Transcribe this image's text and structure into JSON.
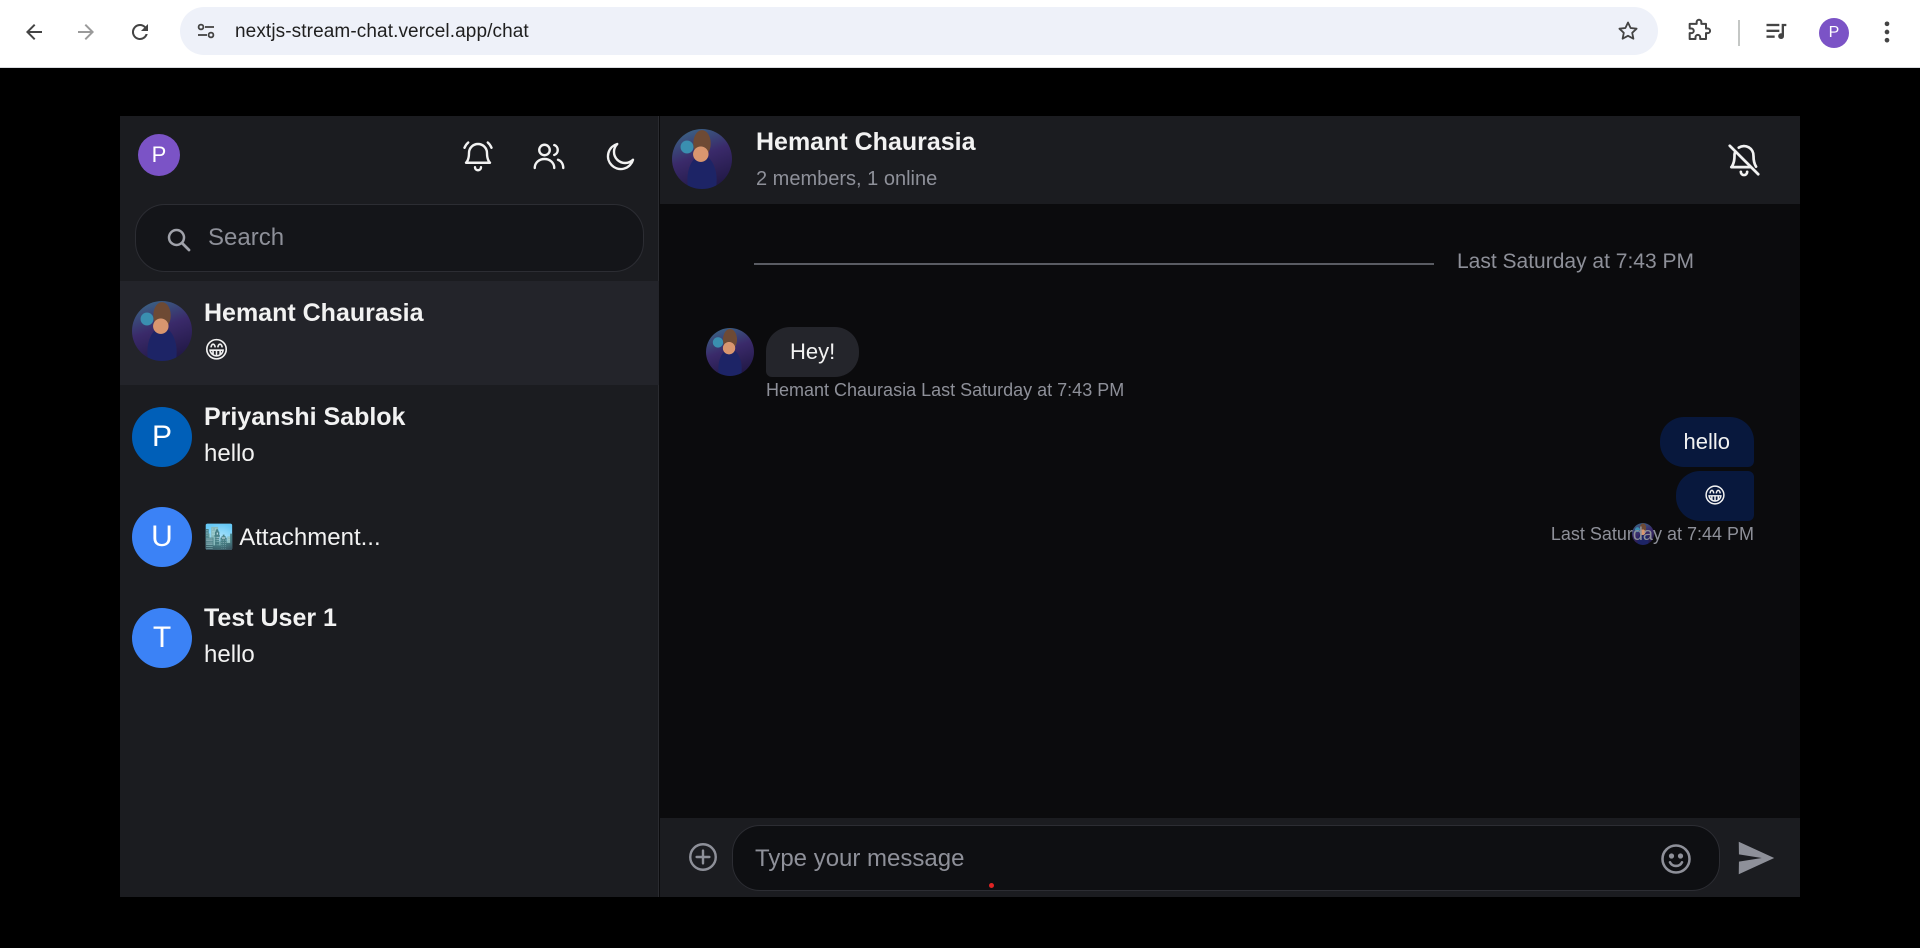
{
  "browser": {
    "url": "nextjs-stream-chat.vercel.app/chat",
    "profile_initial": "P",
    "icons": [
      "back-icon",
      "forward-icon",
      "reload-icon",
      "site-settings-icon",
      "star-icon",
      "extensions-icon",
      "media-icon",
      "more-icon"
    ]
  },
  "sidebar": {
    "me_initial": "P",
    "search_placeholder": "Search",
    "header_icons": [
      "notifications-icon",
      "users-icon",
      "dark-mode-icon"
    ],
    "channels": [
      {
        "name": "Hemant Chaurasia",
        "preview": "😁",
        "avatar_initial": "",
        "avatar_type": "photo",
        "active": true
      },
      {
        "name": "Priyanshi Sablok",
        "preview": "hello",
        "avatar_initial": "P",
        "avatar_color": "#005fb8"
      },
      {
        "name": "",
        "preview": "🏙️ Attachment...",
        "avatar_initial": "U",
        "avatar_color": "#3b82f6"
      },
      {
        "name": "Test User 1",
        "preview": "hello",
        "avatar_initial": "T",
        "avatar_color": "#3b82f6"
      }
    ]
  },
  "chat": {
    "title": "Hemant Chaurasia",
    "subtitle": "2 members, 1 online",
    "date_separator": "Last Saturday at 7:43 PM",
    "incoming": {
      "text": "Hey!",
      "author": "Hemant Chaurasia",
      "time": "Last Saturday at 7:43 PM"
    },
    "outgoing": {
      "messages": [
        "hello",
        "😁"
      ],
      "time": "Last Saturday at 7:44 PM"
    },
    "composer_placeholder": "Type your message"
  },
  "colors": {
    "sidebar_bg": "#1b1c20",
    "chat_bg": "#0b0b0d",
    "outgoing_bubble": "#08183d",
    "incoming_bubble": "#24252b",
    "profile_purple": "#7b53c6"
  }
}
